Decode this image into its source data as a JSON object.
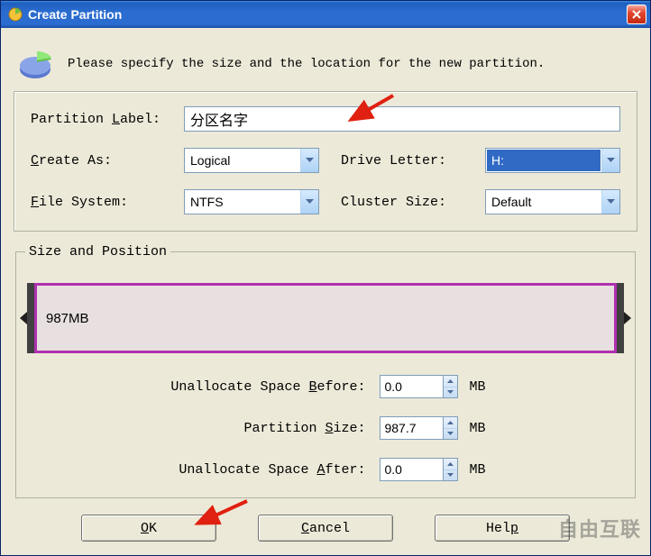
{
  "window": {
    "title": "Create Partition"
  },
  "intro": "Please specify the size and the location for the new partition.",
  "form": {
    "partition_label_label": "Partition ",
    "partition_label_ul": "L",
    "partition_label_after": "abel:",
    "partition_label_value": "分区名字",
    "create_as_ul": "C",
    "create_as_after": "reate As:",
    "create_as_value": "Logical",
    "drive_letter_ul": "D",
    "drive_letter_after": "rive Letter:",
    "drive_letter_value": "H:",
    "file_system_ul": "F",
    "file_system_after": "ile System:",
    "file_system_value": "NTFS",
    "cluster_size_label": "Cluster Si",
    "cluster_size_ul": "z",
    "cluster_size_after": "e:",
    "cluster_size_value": "Default"
  },
  "size_position": {
    "legend": "Size and Position",
    "bar_text": "987MB",
    "before_label_pre": "Unallocate Space ",
    "before_label_ul": "B",
    "before_label_after": "efore:",
    "before_value": "0.0",
    "size_label_pre": "Partition ",
    "size_label_ul": "S",
    "size_label_after": "ize:",
    "size_value": "987.7",
    "after_label_pre": "Unallocate Space ",
    "after_label_ul": "A",
    "after_label_after": "fter:",
    "after_value": "0.0",
    "unit": "MB"
  },
  "buttons": {
    "ok_ul": "O",
    "ok_after": "K",
    "cancel_ul": "C",
    "cancel_after": "ancel",
    "help_label": "Hel",
    "help_ul": "p"
  },
  "watermark": "自由互联"
}
